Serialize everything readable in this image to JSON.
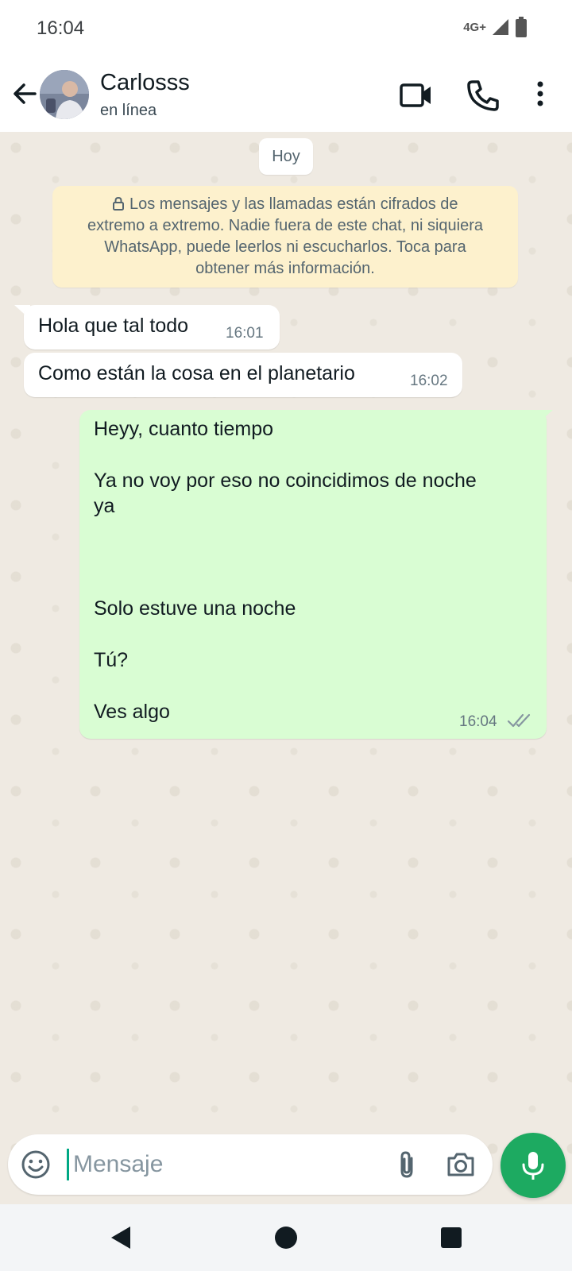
{
  "status_bar": {
    "time": "16:04",
    "network": "4G+",
    "icons": [
      "signal-icon",
      "battery-icon"
    ]
  },
  "header": {
    "contact_name": "Carlosss",
    "contact_status": "en línea",
    "icons": [
      "back-arrow-icon",
      "video-call-icon",
      "phone-icon",
      "more-vert-icon"
    ]
  },
  "chat": {
    "date_label": "Hoy",
    "encryption_notice": {
      "lines": [
        "Los mensajes y las llamadas están cifrados de",
        "extremo a extremo. Nadie fuera de este chat, ni siquiera",
        "WhatsApp, puede leerlos ni escucharlos. Toca para",
        "obtener más información."
      ],
      "icon": "lock-icon"
    },
    "messages": [
      {
        "direction": "incoming",
        "text": "Hola que tal todo",
        "time": "16:01"
      },
      {
        "direction": "incoming",
        "text": "Como están la cosa en el planetario",
        "time": "16:02"
      },
      {
        "direction": "outgoing",
        "lines": [
          "Heyy, cuanto tiempo",
          "Ya no voy por eso no coincidimos de noche",
          "ya",
          "Solo estuve una noche",
          "Tú?",
          "Ves algo"
        ],
        "time": "16:04",
        "status": "delivered-double-check"
      }
    ]
  },
  "input": {
    "placeholder": "Mensaje",
    "icons": [
      "emoji-icon",
      "attach-icon",
      "camera-icon",
      "mic-icon"
    ]
  },
  "colors": {
    "accent_green": "#1daa61",
    "outgoing_bubble": "#d9fdd3",
    "incoming_bubble": "#ffffff",
    "chat_background": "#efeae2",
    "notice_background": "#fdf1cd"
  }
}
